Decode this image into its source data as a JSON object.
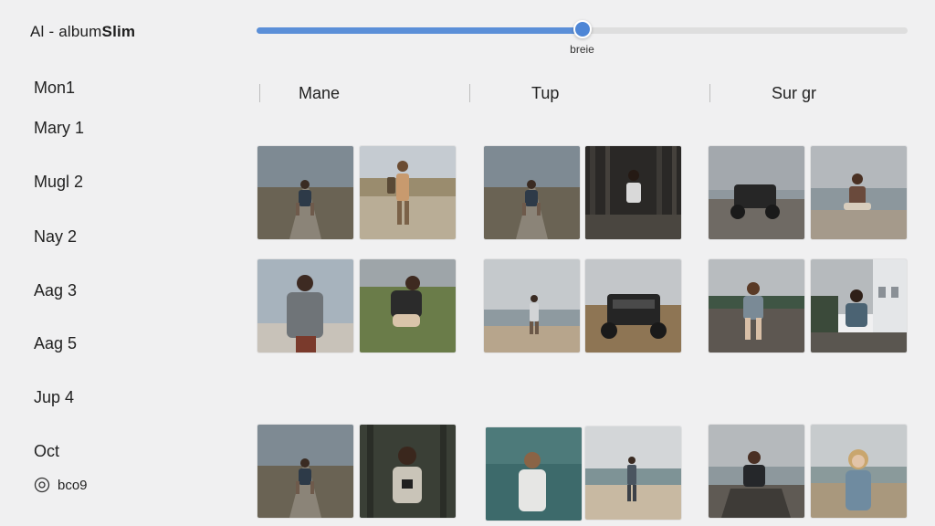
{
  "header": {
    "title_prefix": "Al -  ",
    "title_thin": "album",
    "title_bold": "Slim",
    "slider": {
      "value": 0.5,
      "caption": "breie"
    }
  },
  "sidebar": {
    "items": [
      "Mon1",
      "Mary 1",
      "Mugl 2",
      "Nay 2",
      "Aag 3",
      "Aag 5",
      "Jup 4",
      "Oct"
    ],
    "footer_label": "bco9"
  },
  "columns": [
    {
      "label": "Mane"
    },
    {
      "label": "Tup"
    },
    {
      "label": "Sur gr"
    }
  ],
  "photos": {
    "row1": [
      "person-on-road",
      "hiker-with-backpack",
      "person-on-road",
      "person-in-forest",
      "jeep-on-beach",
      "person-sitting-on-beach"
    ],
    "row2": [
      "girl-in-sweater",
      "girl-crouching-in-grass",
      "person-walking-on-beach",
      "jeep-front",
      "girl-on-pier",
      "girl-by-building"
    ],
    "row3": [
      "person-on-road",
      "girl-in-forest",
      "girl-at-sea",
      "person-walking-on-shore",
      "girl-on-boardwalk",
      "blonde-girl-on-beach"
    ]
  },
  "colors": {
    "background": "#f0f0f1",
    "accent": "#5b8fd8",
    "text": "#1e1e1e"
  }
}
